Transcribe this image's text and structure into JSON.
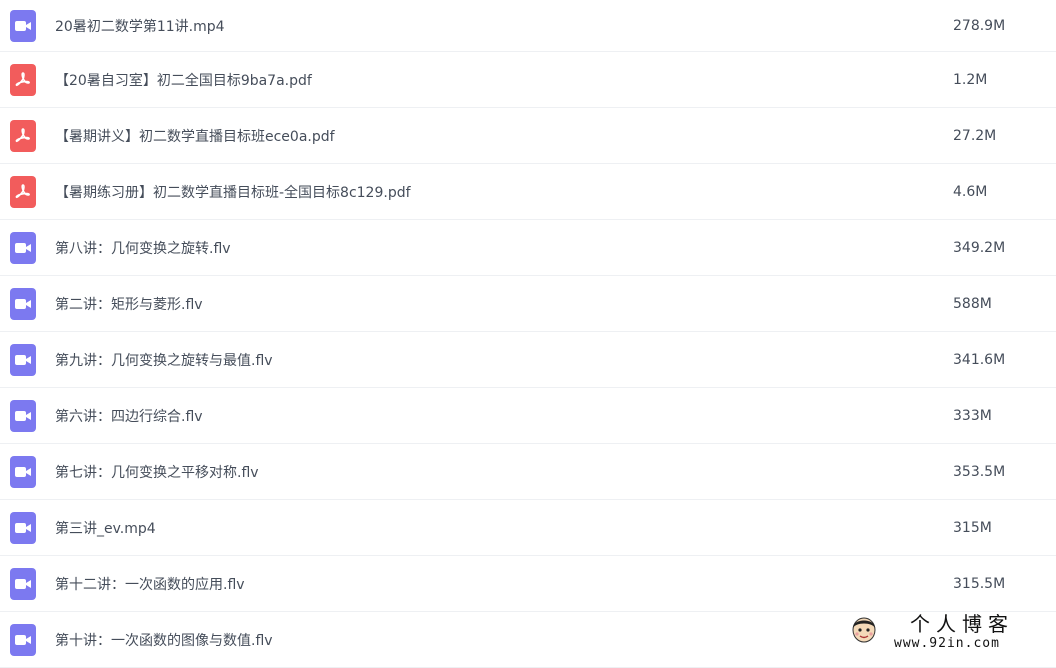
{
  "files": [
    {
      "name": "20暑初二数学第11讲.mp4",
      "size": "278.9M",
      "type": "video",
      "icon": "video-icon"
    },
    {
      "name": "【20暑自习室】初二全国目标9ba7a.pdf",
      "size": "1.2M",
      "type": "pdf",
      "icon": "pdf-icon"
    },
    {
      "name": "【暑期讲义】初二数学直播目标班ece0a.pdf",
      "size": "27.2M",
      "type": "pdf",
      "icon": "pdf-icon"
    },
    {
      "name": "【暑期练习册】初二数学直播目标班-全国目标8c129.pdf",
      "size": "4.6M",
      "type": "pdf",
      "icon": "pdf-icon"
    },
    {
      "name": "第八讲：几何变换之旋转.flv",
      "size": "349.2M",
      "type": "video",
      "icon": "video-icon"
    },
    {
      "name": "第二讲：矩形与菱形.flv",
      "size": "588M",
      "type": "video",
      "icon": "video-icon"
    },
    {
      "name": "第九讲：几何变换之旋转与最值.flv",
      "size": "341.6M",
      "type": "video",
      "icon": "video-icon"
    },
    {
      "name": "第六讲：四边行综合.flv",
      "size": "333M",
      "type": "video",
      "icon": "video-icon"
    },
    {
      "name": "第七讲：几何变换之平移对称.flv",
      "size": "353.5M",
      "type": "video",
      "icon": "video-icon"
    },
    {
      "name": "第三讲_ev.mp4",
      "size": "315M",
      "type": "video",
      "icon": "video-icon"
    },
    {
      "name": "第十二讲：一次函数的应用.flv",
      "size": "315.5M",
      "type": "video",
      "icon": "video-icon"
    },
    {
      "name": "第十讲：一次函数的图像与数值.flv",
      "size": "",
      "type": "video",
      "icon": "video-icon"
    }
  ],
  "watermark": {
    "title": "个人博客",
    "url": "www.92in.com",
    "icon": "cartoon-face-icon"
  },
  "colors": {
    "video": "#7c79f0",
    "pdf": "#f25c5c",
    "text": "#454d5a",
    "divider": "#eef0f3"
  }
}
